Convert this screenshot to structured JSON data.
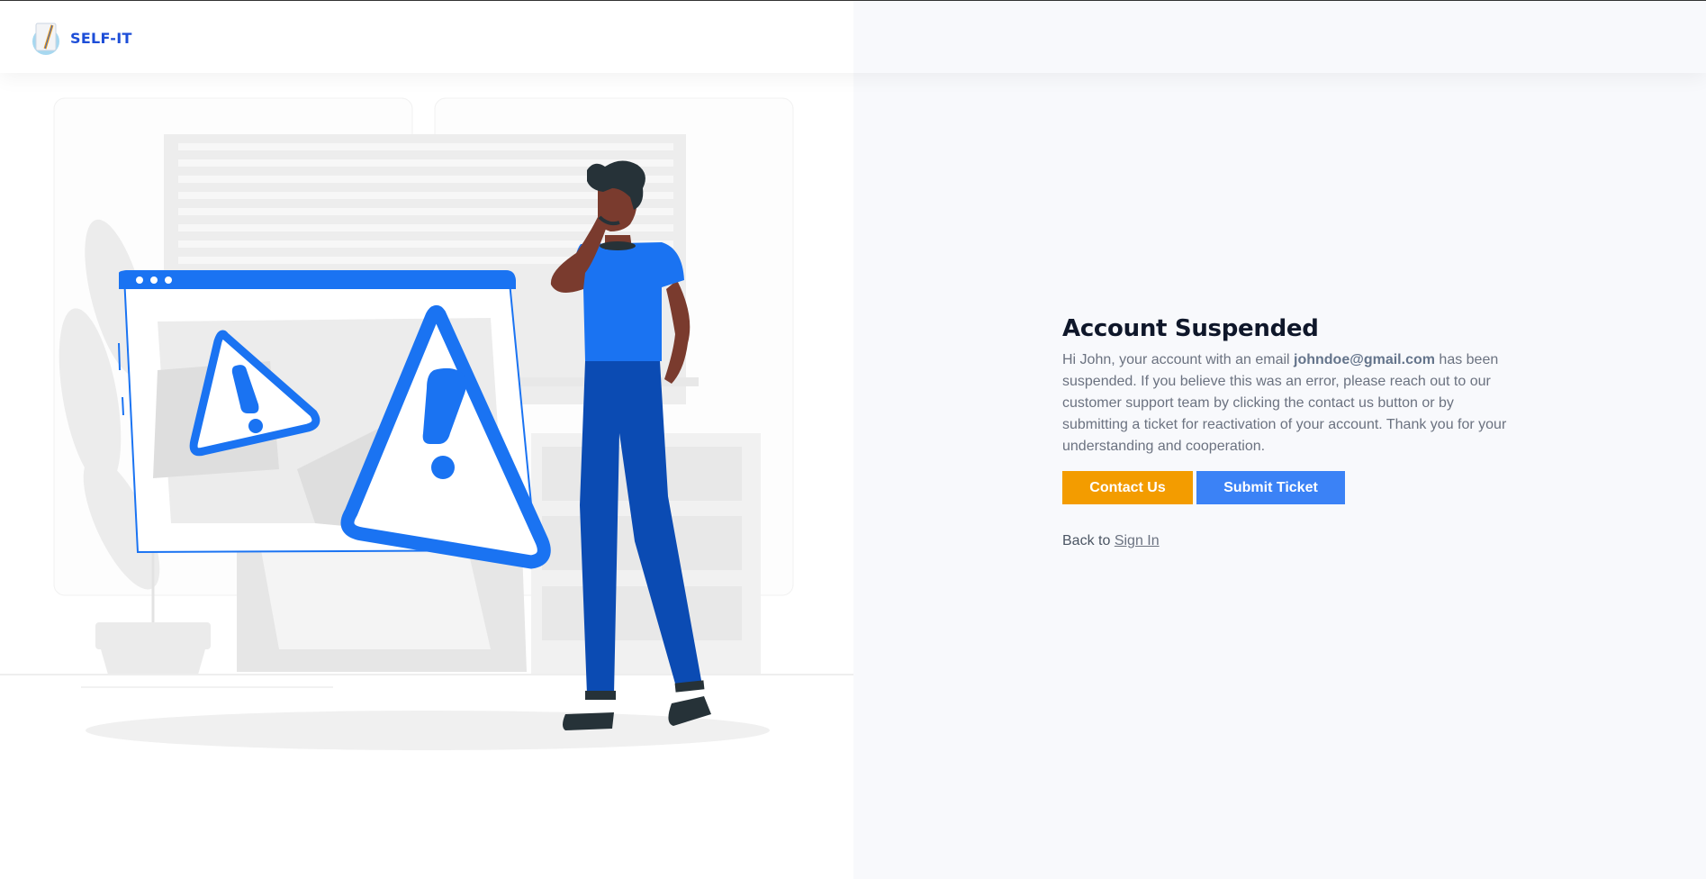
{
  "header": {
    "logo_text": "SELF-IT"
  },
  "illustration": {
    "description_icon": "warning-illustration"
  },
  "main": {
    "title": "Account Suspended",
    "message_before": "Hi John, your account with an email ",
    "email": "johndoe@gmail.com",
    "message_after": " has been suspended. If you believe this was an error, please reach out to our customer support team by clicking the contact us button or by submitting a ticket for reactivation of your account. Thank you for your understanding and cooperation.",
    "contact_label": "Contact Us",
    "ticket_label": "Submit Ticket",
    "back_prefix": "Back to ",
    "signin_label": "Sign In"
  },
  "colors": {
    "brand": "#1d4ed8",
    "contact": "#f39c00",
    "ticket": "#3b82f6",
    "illustration_blue": "#1a73f2"
  }
}
